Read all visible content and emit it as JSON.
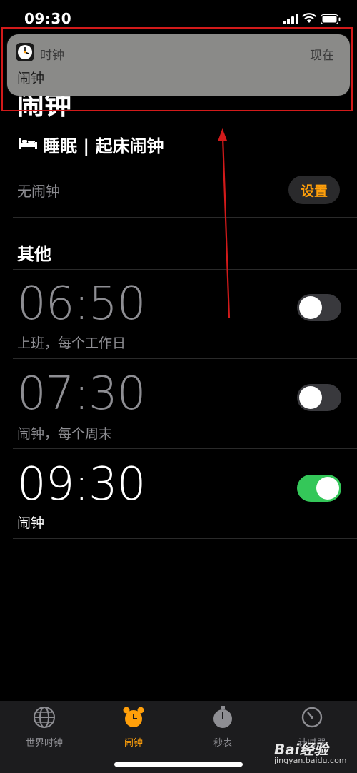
{
  "status_bar": {
    "time": "09:30"
  },
  "large_title": "闹钟",
  "notification": {
    "app_name": "时钟",
    "time": "现在",
    "body": "闹钟"
  },
  "sleep": {
    "title": "睡眠 | 起床闹钟",
    "no_alarm": "无闹钟",
    "set_button": "设置"
  },
  "other": {
    "title": "其他"
  },
  "alarms": [
    {
      "time": "06:50",
      "label": "上班，每个工作日",
      "enabled": false
    },
    {
      "time": "07:30",
      "label": "闹钟，每个周末",
      "enabled": false
    },
    {
      "time": "09:30",
      "label": "闹钟",
      "enabled": true
    }
  ],
  "tabs": [
    {
      "label": "世界时钟",
      "icon": "globe-icon",
      "active": false
    },
    {
      "label": "闹钟",
      "icon": "alarm-clock-icon",
      "active": true
    },
    {
      "label": "秒表",
      "icon": "stopwatch-icon",
      "active": false
    },
    {
      "label": "计时器",
      "icon": "timer-icon",
      "active": false
    }
  ],
  "watermark": {
    "text": "Bai经验",
    "sub": "jingyan.baidu.com"
  },
  "colors": {
    "accent": "#ff9f0a",
    "toggle_on": "#34c759",
    "annotation_red": "#d21a1a"
  }
}
